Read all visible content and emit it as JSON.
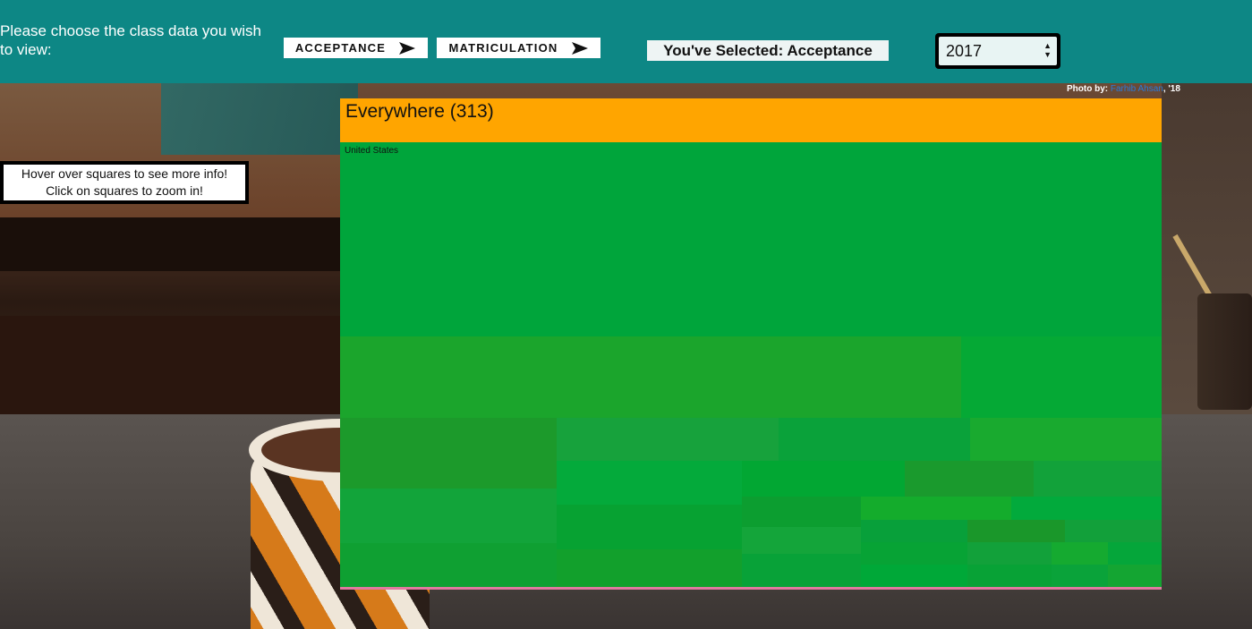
{
  "header": {
    "prompt": "Please choose the class data you wish to view:",
    "buttons": {
      "acceptance": "ACCEPTANCE",
      "matriculation": "MATRICULATION"
    },
    "selected_label": "You've Selected: Acceptance",
    "year_select": {
      "value": "2017"
    }
  },
  "photo_credit": {
    "prefix": "Photo by: ",
    "name": "Farhib Ahsan",
    "suffix": ", '18"
  },
  "hint": {
    "line1": "Hover over squares to see more info!",
    "line2": "Click on squares to zoom in!"
  },
  "treemap": {
    "title": "Everywhere (313)",
    "first_label": "United States",
    "colors": {
      "header": "#ffa500",
      "base": "#00a23a"
    }
  }
}
